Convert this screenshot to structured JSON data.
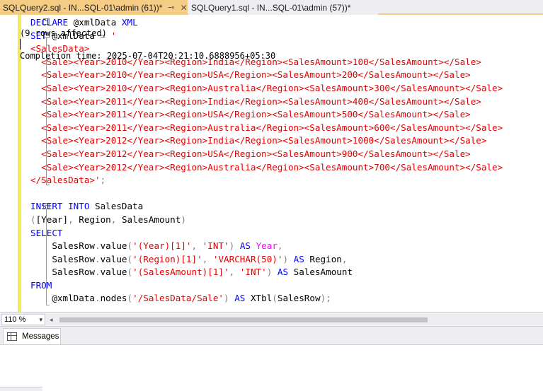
{
  "tabs": [
    {
      "label": "SQLQuery2.sql - IN...SQL-01\\admin (61))*",
      "pin": "⊸",
      "close": "✕"
    },
    {
      "label": "SQLQuery1.sql - IN...SQL-01\\admin (57))*",
      "close": "✕"
    }
  ],
  "editor": {
    "lines": [
      [
        {
          "t": "DECLARE",
          "c": "kw"
        },
        {
          "t": " @xmlData ",
          "c": "fn"
        },
        {
          "t": "XML",
          "c": "kw"
        }
      ],
      [
        {
          "t": "SET",
          "c": "kw"
        },
        {
          "t": " @xmlData ",
          "c": "fn"
        },
        {
          "t": "=",
          "c": "gray"
        },
        {
          "t": " '",
          "c": "str"
        }
      ],
      [
        {
          "t": "<SalesData>",
          "c": "str"
        }
      ],
      [
        {
          "t": "  <Sale><Year>2010</Year><Region>India</Region><SalesAmount>100</SalesAmount></Sale>",
          "c": "str"
        }
      ],
      [
        {
          "t": "  <Sale><Year>2010</Year><Region>USA</Region><SalesAmount>200</SalesAmount></Sale>",
          "c": "str"
        }
      ],
      [
        {
          "t": "  <Sale><Year>2010</Year><Region>Australia</Region><SalesAmount>300</SalesAmount></Sale>",
          "c": "str"
        }
      ],
      [
        {
          "t": "  <Sale><Year>2011</Year><Region>India</Region><SalesAmount>400</SalesAmount></Sale>",
          "c": "str"
        }
      ],
      [
        {
          "t": "  <Sale><Year>2011</Year><Region>USA</Region><SalesAmount>500</SalesAmount></Sale>",
          "c": "str"
        }
      ],
      [
        {
          "t": "  <Sale><Year>2011</Year><Region>Australia</Region><SalesAmount>600</SalesAmount></Sale>",
          "c": "str"
        }
      ],
      [
        {
          "t": "  <Sale><Year>2012</Year><Region>India</Region><SalesAmount>1000</SalesAmount></Sale>",
          "c": "str"
        }
      ],
      [
        {
          "t": "  <Sale><Year>2012</Year><Region>USA</Region><SalesAmount>900</SalesAmount></Sale>",
          "c": "str"
        }
      ],
      [
        {
          "t": "  <Sale><Year>2012</Year><Region>Australia</Region><SalesAmount>700</SalesAmount></Sale>",
          "c": "str"
        }
      ],
      [
        {
          "t": "</SalesData>'",
          "c": "str"
        },
        {
          "t": ";",
          "c": "gray"
        }
      ],
      [],
      [
        {
          "t": "INSERT",
          "c": "kw"
        },
        {
          "t": " ",
          "c": "fn"
        },
        {
          "t": "INTO",
          "c": "kw"
        },
        {
          "t": " SalesData",
          "c": "fn"
        }
      ],
      [
        {
          "t": "(",
          "c": "gray"
        },
        {
          "t": "[Year]",
          "c": "fn"
        },
        {
          "t": ",",
          "c": "gray"
        },
        {
          "t": " Region",
          "c": "fn"
        },
        {
          "t": ",",
          "c": "gray"
        },
        {
          "t": " SalesAmount",
          "c": "fn"
        },
        {
          "t": ")",
          "c": "gray"
        }
      ],
      [
        {
          "t": "SELECT",
          "c": "kw"
        }
      ],
      [
        {
          "t": "    SalesRow",
          "c": "fn"
        },
        {
          "t": ".",
          "c": "gray"
        },
        {
          "t": "value",
          "c": "fn"
        },
        {
          "t": "(",
          "c": "gray"
        },
        {
          "t": "'(Year)[1]'",
          "c": "str"
        },
        {
          "t": ",",
          "c": "gray"
        },
        {
          "t": " ",
          "c": "fn"
        },
        {
          "t": "'INT'",
          "c": "str"
        },
        {
          "t": ")",
          "c": "gray"
        },
        {
          "t": " ",
          "c": "fn"
        },
        {
          "t": "AS",
          "c": "kw"
        },
        {
          "t": " ",
          "c": "fn"
        },
        {
          "t": "Year",
          "c": "mag"
        },
        {
          "t": ",",
          "c": "gray"
        }
      ],
      [
        {
          "t": "    SalesRow",
          "c": "fn"
        },
        {
          "t": ".",
          "c": "gray"
        },
        {
          "t": "value",
          "c": "fn"
        },
        {
          "t": "(",
          "c": "gray"
        },
        {
          "t": "'(Region)[1]'",
          "c": "str"
        },
        {
          "t": ",",
          "c": "gray"
        },
        {
          "t": " ",
          "c": "fn"
        },
        {
          "t": "'VARCHAR(50)'",
          "c": "str"
        },
        {
          "t": ")",
          "c": "gray"
        },
        {
          "t": " ",
          "c": "fn"
        },
        {
          "t": "AS",
          "c": "kw"
        },
        {
          "t": " Region",
          "c": "fn"
        },
        {
          "t": ",",
          "c": "gray"
        }
      ],
      [
        {
          "t": "    SalesRow",
          "c": "fn"
        },
        {
          "t": ".",
          "c": "gray"
        },
        {
          "t": "value",
          "c": "fn"
        },
        {
          "t": "(",
          "c": "gray"
        },
        {
          "t": "'(SalesAmount)[1]'",
          "c": "str"
        },
        {
          "t": ",",
          "c": "gray"
        },
        {
          "t": " ",
          "c": "fn"
        },
        {
          "t": "'INT'",
          "c": "str"
        },
        {
          "t": ")",
          "c": "gray"
        },
        {
          "t": " ",
          "c": "fn"
        },
        {
          "t": "AS",
          "c": "kw"
        },
        {
          "t": " SalesAmount",
          "c": "fn"
        }
      ],
      [
        {
          "t": "FROM",
          "c": "kw"
        }
      ],
      [
        {
          "t": "    @xmlData",
          "c": "fn"
        },
        {
          "t": ".",
          "c": "gray"
        },
        {
          "t": "nodes",
          "c": "fn"
        },
        {
          "t": "(",
          "c": "gray"
        },
        {
          "t": "'/SalesData/Sale'",
          "c": "str"
        },
        {
          "t": ")",
          "c": "gray"
        },
        {
          "t": " ",
          "c": "fn"
        },
        {
          "t": "AS",
          "c": "kw"
        },
        {
          "t": " XTbl",
          "c": "fn"
        },
        {
          "t": "(",
          "c": "gray"
        },
        {
          "t": "SalesRow",
          "c": "fn"
        },
        {
          "t": ");",
          "c": "gray"
        }
      ]
    ]
  },
  "zoom": {
    "value": "110 %",
    "dropdown": "▾",
    "scroll_left": "◂"
  },
  "results": {
    "tab_label": "Messages",
    "rows_affected": "(9 rows affected)",
    "completion": "Completion time: 2025-07-04T20:21:10.6888956+05:30"
  },
  "colors": {
    "active_tab": "#f5cc84",
    "keyword": "#0000ff",
    "string": "#e00000",
    "change_bar": "#f3e95a"
  }
}
